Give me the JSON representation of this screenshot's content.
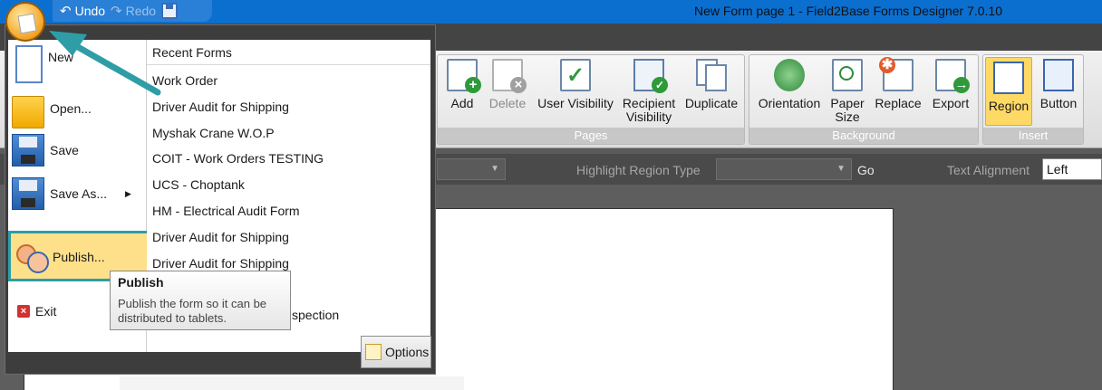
{
  "titlebar": {
    "undo_label": "Undo",
    "redo_label": "Redo",
    "window_title": "New Form page 1 - Field2Base Forms Designer 7.0.10"
  },
  "ribbon": {
    "pages": {
      "caption": "Pages",
      "add": "Add",
      "delete": "Delete",
      "user_visibility": "User Visibility",
      "recipient_visibility_1": "Recipient",
      "recipient_visibility_2": "Visibility",
      "duplicate": "Duplicate"
    },
    "background": {
      "caption": "Background",
      "orientation": "Orientation",
      "paper_size_1": "Paper",
      "paper_size_2": "Size",
      "replace": "Replace",
      "export": "Export"
    },
    "insert": {
      "caption": "Insert",
      "region": "Region",
      "button": "Button"
    }
  },
  "toolbar": {
    "highlight_label": "Highlight Region Type",
    "go_label": "Go",
    "text_alignment_label": "Text Alignment",
    "text_alignment_value": "Left"
  },
  "appmenu": {
    "items": {
      "new": "New",
      "open": "Open...",
      "save": "Save",
      "save_as": "Save As...",
      "publish": "Publish...",
      "exit": "Exit"
    },
    "recent_header": "Recent Forms",
    "recent": [
      "Work Order",
      "Driver Audit for Shipping",
      "Myshak Crane W.O.P",
      "COIT - Work Orders TESTING",
      "UCS - Choptank",
      "HM - Electrical Audit Form",
      "Driver Audit for Shipping",
      "Driver Audit for Shipping"
    ],
    "recent_tail": "spection",
    "options_label": "Options"
  },
  "tooltip": {
    "title": "Publish",
    "body": "Publish the form so it can be distributed to tablets."
  },
  "colors": {
    "accent_blue": "#0b6fd0",
    "annotation_teal": "#2e9da6",
    "highlight_yellow": "#ffd966"
  }
}
